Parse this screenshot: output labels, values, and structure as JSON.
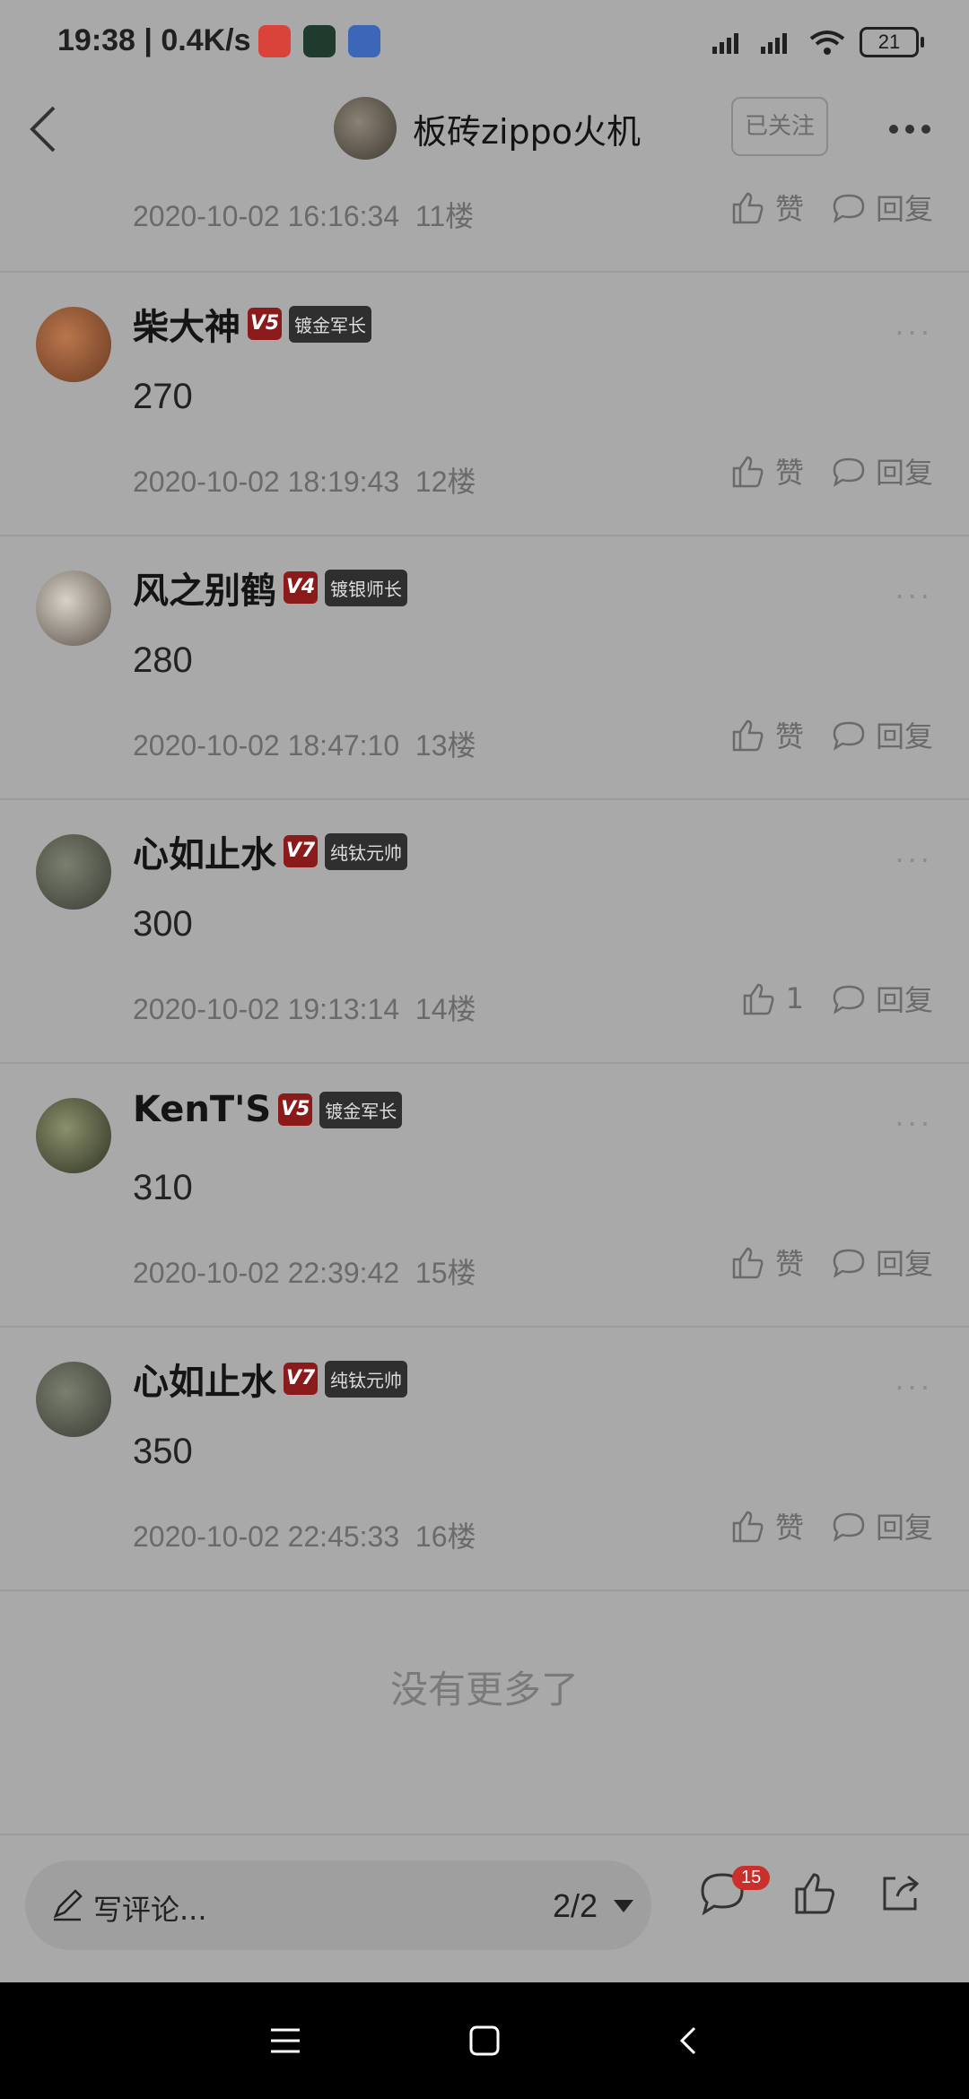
{
  "statusbar": {
    "time_speed": "19:38 | 0.4K/s",
    "battery": "21"
  },
  "header": {
    "title": "板砖zippo火机",
    "follow_label": "已关注"
  },
  "partial_comment": {
    "timestamp": "2020-10-02 16:16:34",
    "floor": "11楼",
    "like_label": "赞",
    "reply_label": "回复"
  },
  "comments": [
    {
      "name": "柴大神",
      "level": "V5",
      "tag": "镀金军长",
      "text": "270",
      "timestamp": "2020-10-02 18:19:43",
      "floor": "12楼",
      "like_label": "赞",
      "reply_label": "回复"
    },
    {
      "name": "风之别鹤",
      "level": "V4",
      "tag": "镀银师长",
      "text": "280",
      "timestamp": "2020-10-02 18:47:10",
      "floor": "13楼",
      "like_label": "赞",
      "reply_label": "回复"
    },
    {
      "name": "心如止水",
      "level": "V7",
      "tag": "纯钛元帅",
      "text": "300",
      "timestamp": "2020-10-02 19:13:14",
      "floor": "14楼",
      "like_label": "1",
      "reply_label": "回复"
    },
    {
      "name": "KenT'S",
      "level": "V5",
      "tag": "镀金军长",
      "text": "310",
      "timestamp": "2020-10-02 22:39:42",
      "floor": "15楼",
      "like_label": "赞",
      "reply_label": "回复"
    },
    {
      "name": "心如止水",
      "level": "V7",
      "tag": "纯钛元帅",
      "text": "350",
      "timestamp": "2020-10-02 22:45:33",
      "floor": "16楼",
      "like_label": "赞",
      "reply_label": "回复"
    }
  ],
  "footer": {
    "no_more": "没有更多了"
  },
  "bottombar": {
    "comment_placeholder": "写评论...",
    "page": "2/2",
    "comment_count": "15"
  },
  "colors": {
    "page_bg": "#a9a9a9",
    "level_badge": "#8b1b1b",
    "count_badge": "#c9302c"
  }
}
